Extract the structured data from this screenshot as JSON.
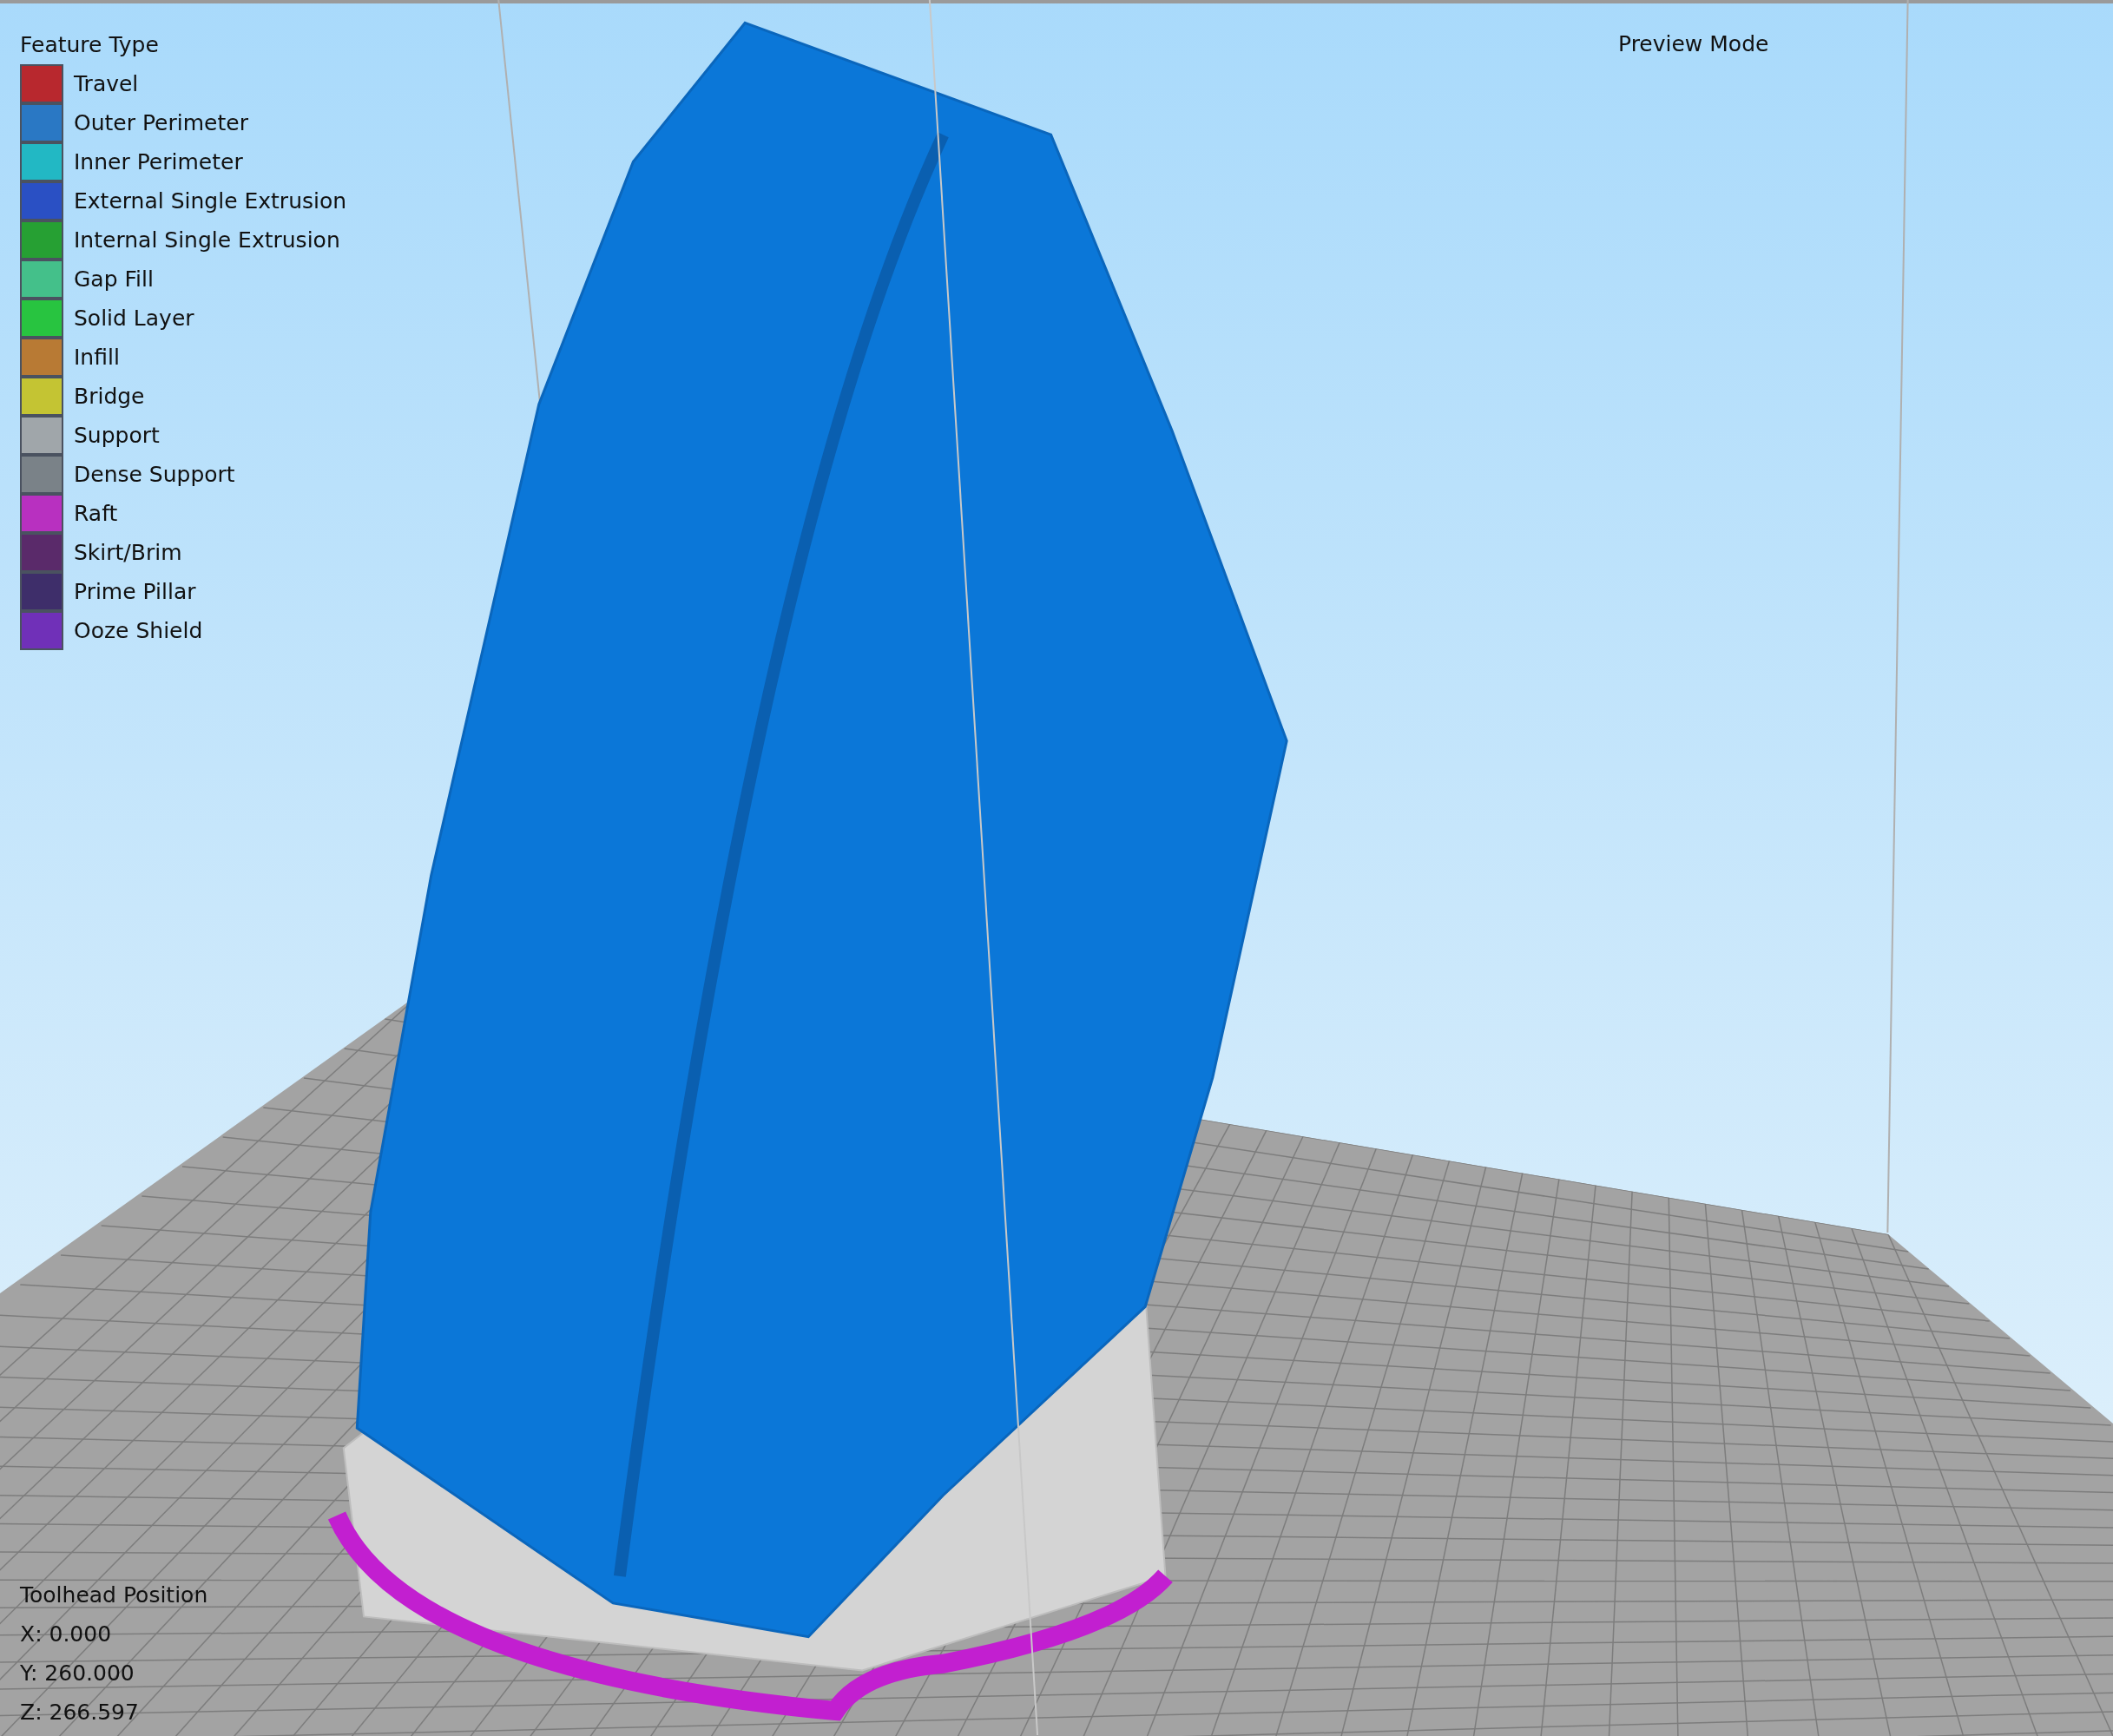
{
  "legend": {
    "title": "Feature Type",
    "items": [
      {
        "label": "Travel",
        "color": "#b8282e"
      },
      {
        "label": "Outer Perimeter",
        "color": "#2a78c4"
      },
      {
        "label": "Inner Perimeter",
        "color": "#22b8c4"
      },
      {
        "label": "External Single Extrusion",
        "color": "#2a50c4"
      },
      {
        "label": "Internal Single Extrusion",
        "color": "#26a033"
      },
      {
        "label": "Gap Fill",
        "color": "#44c08a"
      },
      {
        "label": "Solid Layer",
        "color": "#28c440"
      },
      {
        "label": "Infill",
        "color": "#b87a34"
      },
      {
        "label": "Bridge",
        "color": "#c4c433"
      },
      {
        "label": "Support",
        "color": "#a0a6aa"
      },
      {
        "label": "Dense Support",
        "color": "#7a8288"
      },
      {
        "label": "Raft",
        "color": "#b830c0"
      },
      {
        "label": "Skirt/Brim",
        "color": "#5a2a6a"
      },
      {
        "label": "Prime Pillar",
        "color": "#3e2e6a"
      },
      {
        "label": "Ooze Shield",
        "color": "#7030b8"
      }
    ]
  },
  "mode_label": "Preview Mode",
  "toolhead": {
    "title": "Toolhead Position",
    "lines": [
      "X: 0.000",
      "Y: 260.000",
      "Z: 266.597"
    ]
  }
}
